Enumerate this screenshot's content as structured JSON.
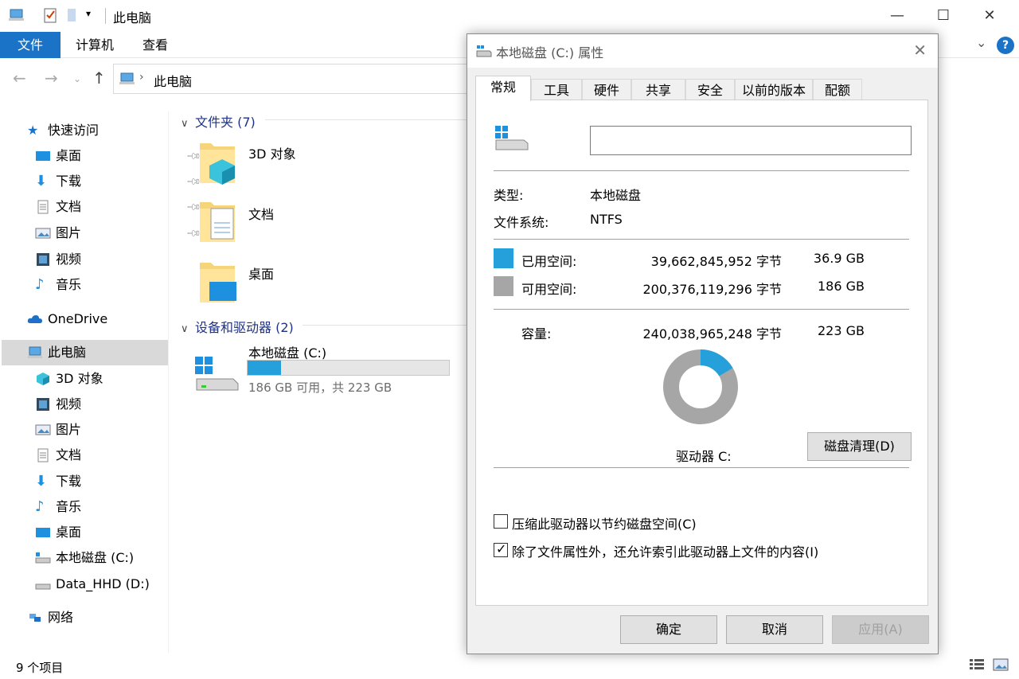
{
  "explorer": {
    "title": "此电脑",
    "ribbon_tabs": [
      "文件",
      "计算机",
      "查看"
    ],
    "address_path": "此电脑",
    "sidebar": {
      "quick_access": "快速访问",
      "quick_items": [
        "桌面",
        "下载",
        "文档",
        "图片",
        "视频",
        "音乐"
      ],
      "onedrive": "OneDrive",
      "this_pc": "此电脑",
      "pc_items": [
        "3D 对象",
        "视频",
        "图片",
        "文档",
        "下载",
        "音乐",
        "桌面",
        "本地磁盘 (C:)",
        "Data_HHD (D:)"
      ],
      "network": "网络"
    },
    "groups": {
      "folders_header": "文件夹 (7)",
      "devices_header": "设备和驱动器 (2)"
    },
    "folders": [
      "3D 对象",
      "文档",
      "桌面"
    ],
    "drive": {
      "name": "本地磁盘 (C:)",
      "usage_text": "186 GB 可用，共 223 GB",
      "used_fraction": 0.165
    },
    "status": "9 个项目",
    "help_label": "?"
  },
  "dialog": {
    "title": "本地磁盘 (C:) 属性",
    "tabs": [
      "常规",
      "工具",
      "硬件",
      "共享",
      "安全",
      "以前的版本",
      "配额"
    ],
    "active_tab": "常规",
    "name_value": "",
    "type_label": "类型:",
    "type_value": "本地磁盘",
    "fs_label": "文件系统:",
    "fs_value": "NTFS",
    "used_label": "已用空间:",
    "used_bytes": "39,662,845,952 字节",
    "used_gb": "36.9 GB",
    "free_label": "可用空间:",
    "free_bytes": "200,376,119,296 字节",
    "free_gb": "186 GB",
    "capacity_label": "容量:",
    "capacity_bytes": "240,038,965,248 字节",
    "capacity_gb": "223 GB",
    "drive_label": "驱动器 C:",
    "cleanup_button": "磁盘清理(D)",
    "compress_label": "压缩此驱动器以节约磁盘空间(C)",
    "compress_checked": false,
    "index_label": "除了文件属性外，还允许索引此驱动器上文件的内容(I)",
    "index_checked": true,
    "ok_button": "确定",
    "cancel_button": "取消",
    "apply_button": "应用(A)",
    "used_color": "#26a0da",
    "free_color": "#a6a6a6",
    "used_fraction": 0.1652
  }
}
